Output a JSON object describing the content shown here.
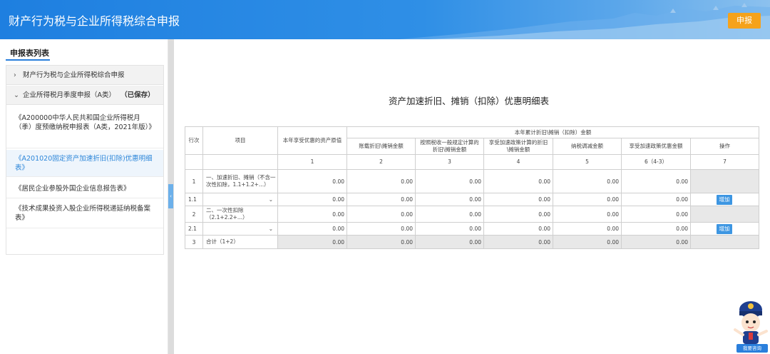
{
  "header": {
    "title": "财产行为税与企业所得税综合申报",
    "submit_label": "申报"
  },
  "sidebar": {
    "heading": "申报表列表",
    "groups": [
      {
        "label": "财产行为税与企业所得税综合申报",
        "expanded": false
      },
      {
        "label": "企业所得税月季度申报（A类）",
        "expanded": true,
        "status": "（已保存）"
      }
    ],
    "items": [
      {
        "label": "《A200000中华人民共和国企业所得税月（季）度预缴纳税申报表（A类，2021年版）》"
      },
      {
        "label": "《A201020固定资产加速折旧(扣除)优惠明细表》",
        "active": true
      },
      {
        "label": "《居民企业参股外国企业信息报告表》"
      },
      {
        "label": "《技术成果投资入股企业所得税递延纳税备案表》"
      }
    ]
  },
  "main": {
    "title": "资产加速折旧、摊销（扣除）优惠明细表",
    "headers": {
      "row_no": "行次",
      "item": "项目",
      "col1": "本年享受优惠的资产原值",
      "group": "本年累计折旧\\摊销（扣除）金额",
      "col2": "账载折旧\\摊销金额",
      "col3": "按照税收一般规定计算的折旧\\摊销金额",
      "col4": "享受加速政策计算的折旧\\摊销金额",
      "col5": "纳税调减金额",
      "col6": "享受加速政策优惠金额",
      "col7": "操作",
      "nums": [
        "1",
        "2",
        "3",
        "4",
        "5",
        "6（4-3）",
        "7"
      ]
    },
    "rows": [
      {
        "no": "1",
        "item": "一、加速折旧、摊销（不含一次性扣除，1.1+1.2+...）",
        "values": [
          "0.00",
          "0.00",
          "0.00",
          "0.00",
          "0.00",
          "0.00"
        ]
      },
      {
        "no": "1.1",
        "item": "",
        "values": [
          "0.00",
          "0.00",
          "0.00",
          "0.00",
          "0.00",
          "0.00"
        ],
        "action": "增加"
      },
      {
        "no": "2",
        "item": "二、一次性扣除（2.1+2.2+...）",
        "values": [
          "0.00",
          "0.00",
          "0.00",
          "0.00",
          "0.00",
          "0.00"
        ]
      },
      {
        "no": "2.1",
        "item": "",
        "values": [
          "0.00",
          "0.00",
          "0.00",
          "0.00",
          "0.00",
          "0.00"
        ],
        "action": "增加"
      },
      {
        "no": "3",
        "item": "合计（1+2）",
        "values": [
          "0.00",
          "0.00",
          "0.00",
          "0.00",
          "0.00",
          "0.00"
        ]
      }
    ]
  },
  "assistant": {
    "label": "我要咨询"
  },
  "colors": {
    "header": "#2a86e3",
    "accent": "#f5a21b",
    "link": "#2c86d9"
  }
}
